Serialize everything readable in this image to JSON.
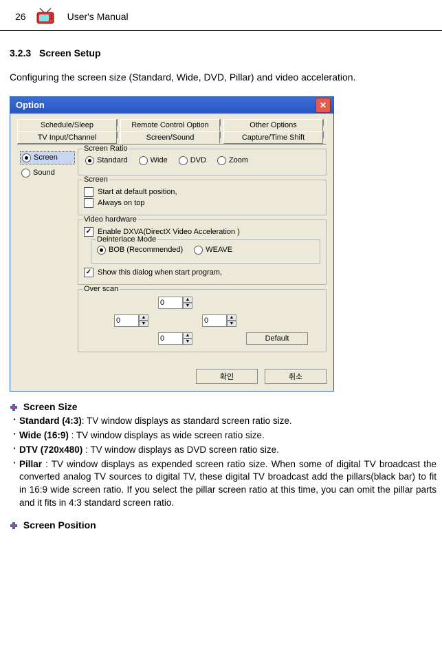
{
  "header": {
    "page_number": "26",
    "title": "User's Manual"
  },
  "section": {
    "number": "3.2.3",
    "title": "Screen Setup",
    "intro": "Configuring the screen size (Standard, Wide, DVD, Pillar) and video acceleration."
  },
  "window": {
    "title": "Option",
    "tabs_top": [
      "Schedule/Sleep",
      "Remote Control Option",
      "Other Options"
    ],
    "tabs_bottom": [
      "TV Input/Channel",
      "Screen/Sound",
      "Capture/Time Shift"
    ],
    "active_tab": "Screen/Sound",
    "side_options": [
      {
        "label": "Screen",
        "selected": true
      },
      {
        "label": "Sound",
        "selected": false
      }
    ],
    "screen_ratio": {
      "legend": "Screen Ratio",
      "options": [
        "Standard",
        "Wide",
        "DVD",
        "Zoom"
      ],
      "selected": "Standard"
    },
    "screen": {
      "legend": "Screen",
      "start_default": {
        "label": "Start at default position,",
        "checked": false
      },
      "always_top": {
        "label": "Always on top",
        "checked": false
      }
    },
    "video_hw": {
      "legend": "Video hardware",
      "enable_dxva": {
        "label": "Enable DXVA(DirectX Video Acceleration )",
        "checked": true
      },
      "deinterlace": {
        "legend": "Deinterlace Mode",
        "options": [
          "BOB (Recommended)",
          "WEAVE"
        ],
        "selected": "BOB (Recommended)"
      },
      "show_dialog": {
        "label": "Show this dialog when start program,",
        "checked": true
      }
    },
    "overscan": {
      "legend": "Over scan",
      "top": "0",
      "left": "0",
      "right": "0",
      "bottom": "0",
      "default_btn": "Default"
    },
    "buttons": {
      "ok": "확인",
      "cancel": "취소"
    }
  },
  "body": {
    "screen_size_title": "Screen Size",
    "items": [
      {
        "bold": "Standard (4:3)",
        "rest": ": TV window displays as standard screen ratio size."
      },
      {
        "bold": "Wide (16:9)",
        "rest": " : TV window displays as wide screen ratio size."
      },
      {
        "bold": "DTV (720x480)",
        "rest": " : TV window displays as DVD screen ratio size."
      },
      {
        "bold": "Pillar",
        "rest": " : TV window displays as expended screen ratio size.   When some of digital TV broadcast the converted analog TV sources to digital TV, these digital TV broadcast add the pillars(black bar) to fit in 16:9 wide screen ratio.  If you select the pillar screen ratio at this time, you can omit the pillar parts and it fits in 4:3 standard screen ratio."
      }
    ],
    "screen_position_title": "Screen Position"
  }
}
